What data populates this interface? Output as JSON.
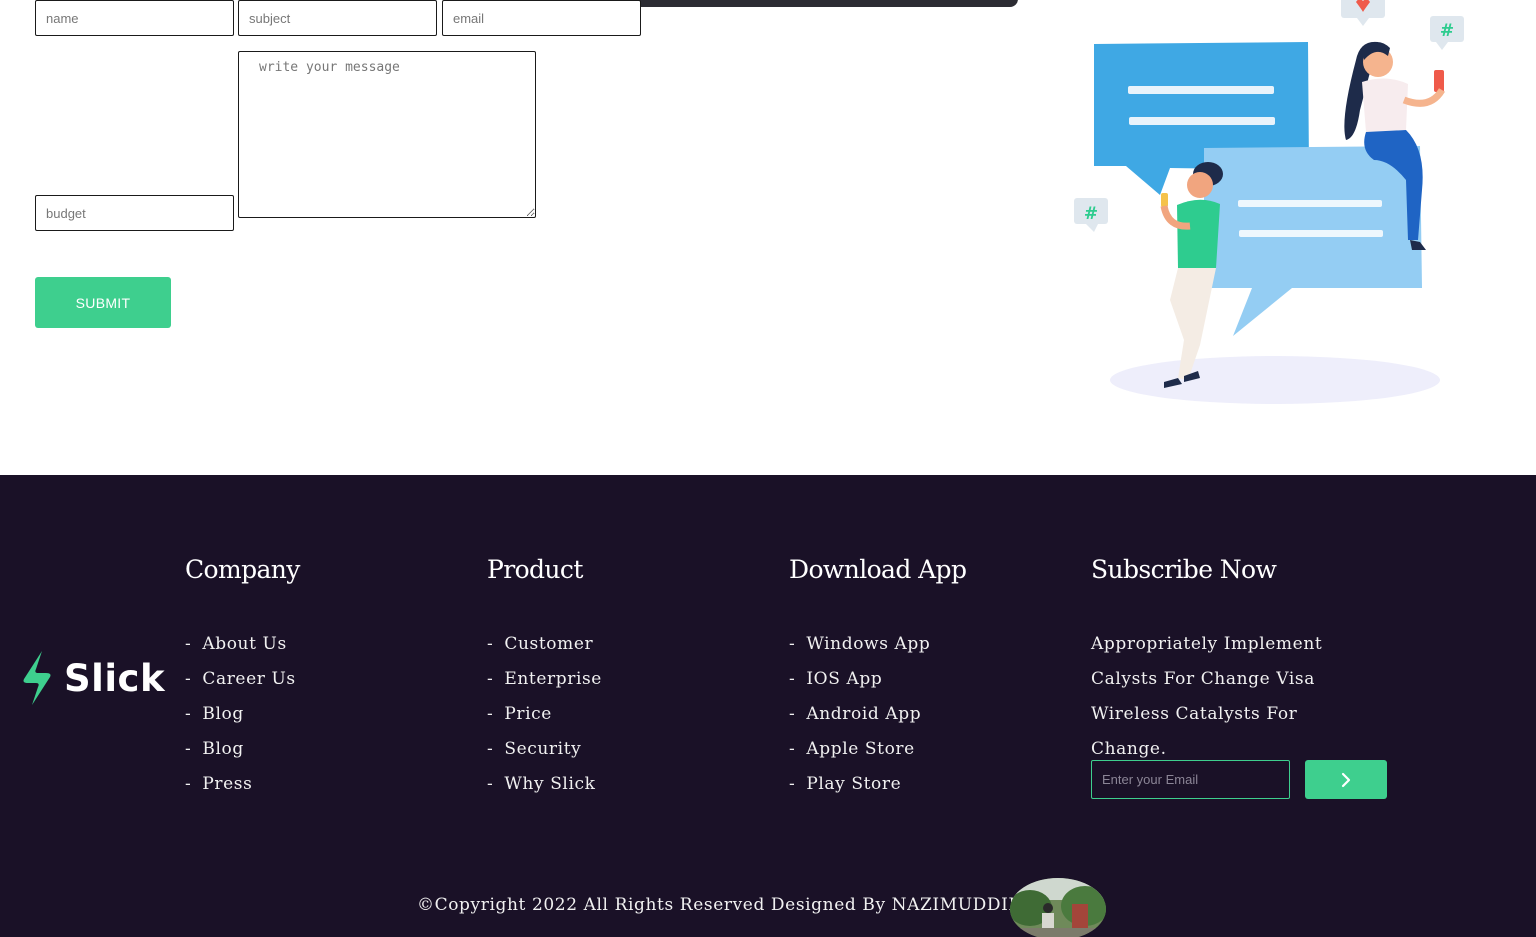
{
  "form": {
    "name_placeholder": "name",
    "subject_placeholder": "subject",
    "email_placeholder": "email",
    "message_placeholder": "write your message",
    "budget_placeholder": "budget",
    "submit_label": "SUBMIT"
  },
  "footer": {
    "logo_text": "Slick",
    "columns": [
      {
        "title": "Company",
        "items": [
          "About Us",
          "Career Us",
          "Blog",
          "Blog",
          "Press"
        ]
      },
      {
        "title": "Product",
        "items": [
          "Customer",
          "Enterprise",
          "Price",
          "Security",
          "Why Slick"
        ]
      },
      {
        "title": "Download App",
        "items": [
          "Windows App",
          "IOS App",
          "Android App",
          "Apple Store",
          "Play Store"
        ]
      }
    ],
    "subscribe": {
      "title": "Subscribe Now",
      "text": "Appropriately Implement Calysts For Change Visa Wireless Catalysts For Change.",
      "email_placeholder": "Enter your Email"
    },
    "dash": "-",
    "copyright": "©Copyright 2022 All Rights Reserved Designed By NAZIMUDDIN."
  },
  "colors": {
    "accent": "#3ecf8e",
    "footer_bg": "#1a1127",
    "text_light": "#f1f1f1"
  },
  "icons": {
    "submit_arrow": "chevron-right-icon",
    "logo_mark": "lightning-icon"
  }
}
